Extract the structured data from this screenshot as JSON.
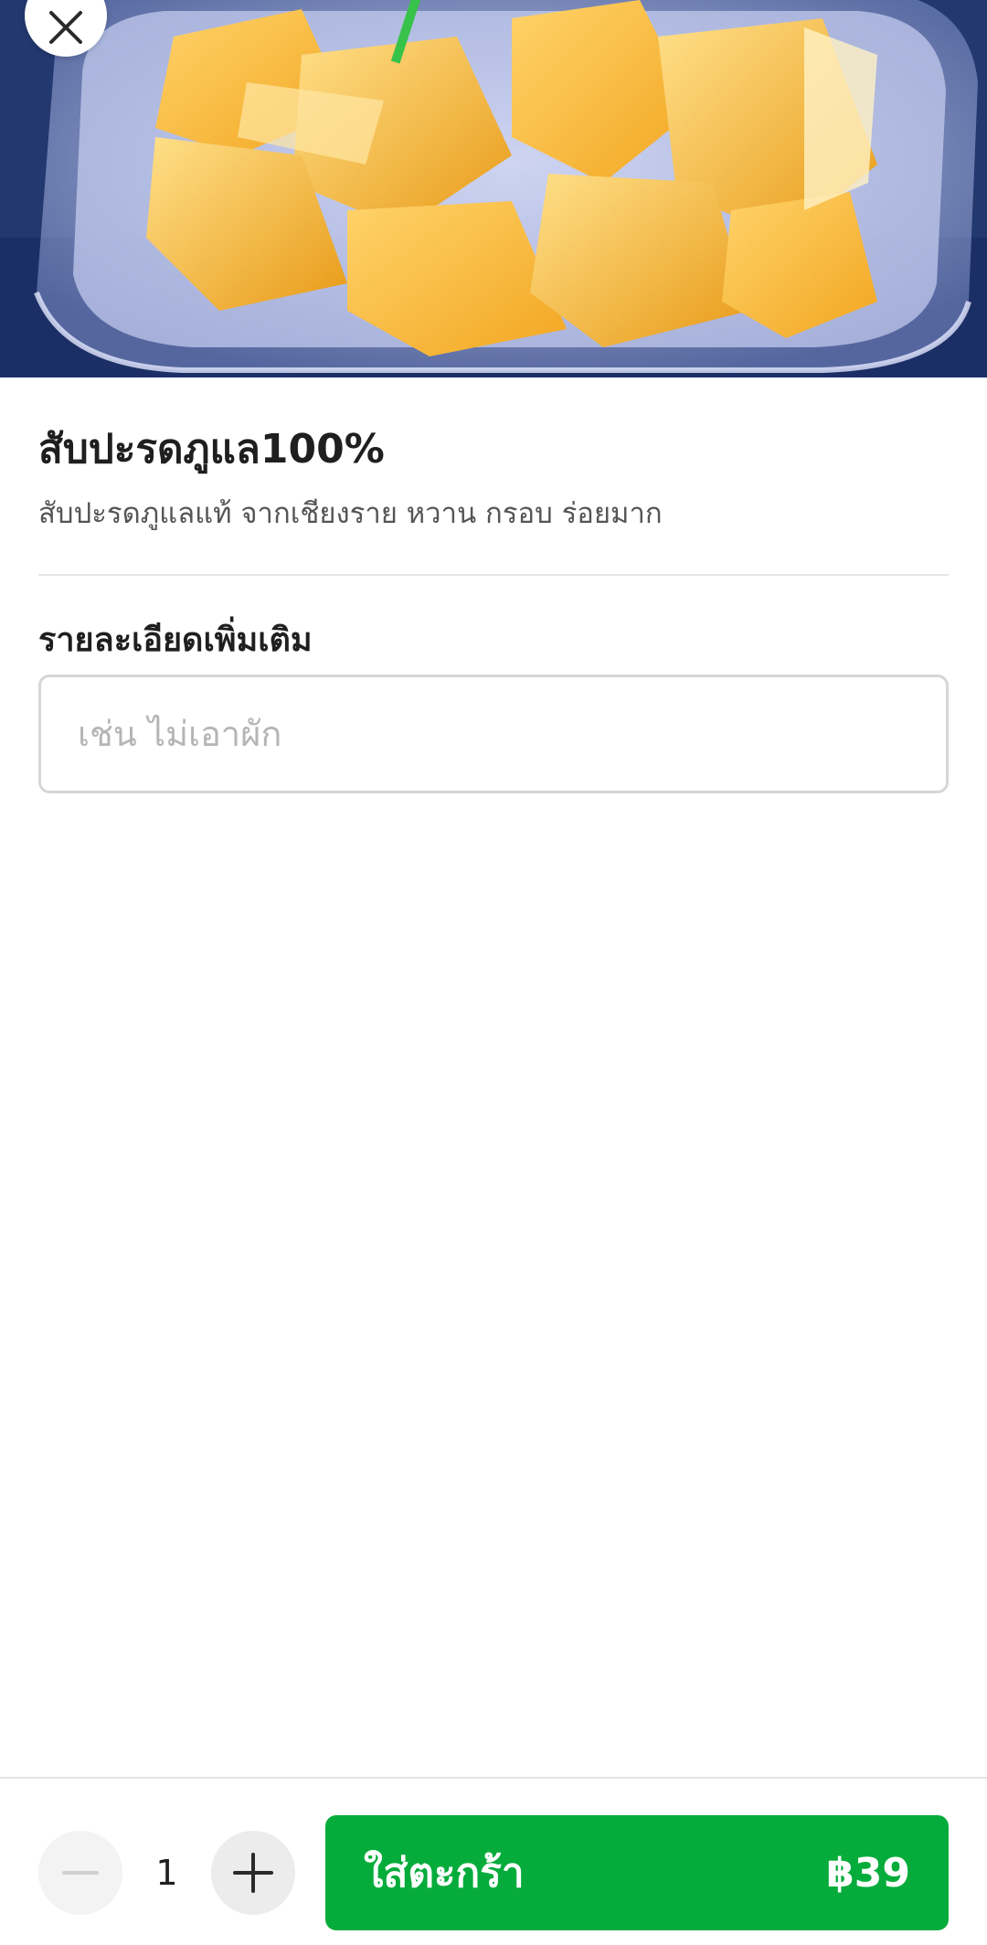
{
  "product": {
    "name": "สับปะรดภูแล100%",
    "description": "สับปะรดภูแลแท้ จากเชียงราย หวาน กรอบ ร่อยมาก"
  },
  "note": {
    "label": "รายละเอียดเพิ่มเติม",
    "placeholder": "เช่น ไม่เอาผัก",
    "value": ""
  },
  "order": {
    "quantity": "1",
    "add_to_cart_label": "ใส่ตะกร้า",
    "price": "฿39"
  },
  "icons": {
    "close": "close-icon",
    "minus": "minus-icon",
    "plus": "plus-icon"
  },
  "colors": {
    "accent_green": "#06ac3b"
  }
}
